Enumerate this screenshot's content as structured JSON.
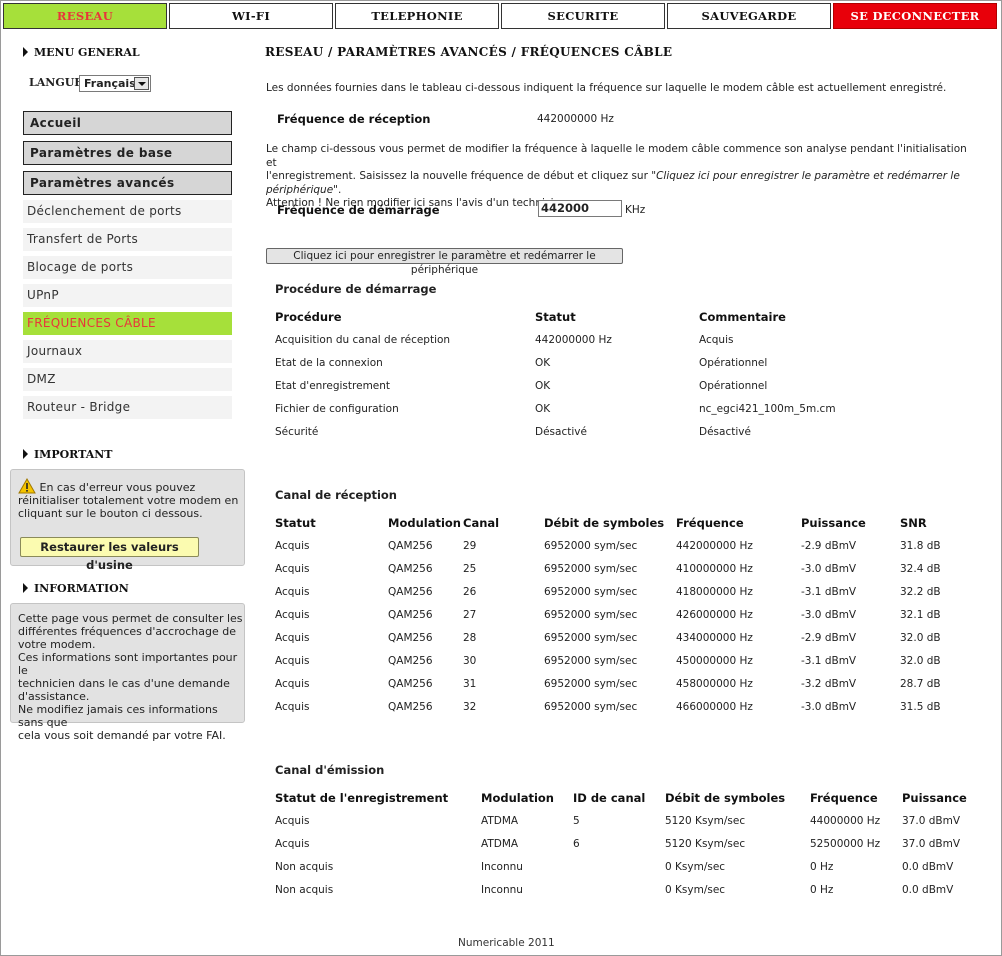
{
  "nav": {
    "tabs": [
      "RESEAU",
      "WI-FI",
      "TELEPHONIE",
      "SECURITE",
      "SAUVEGARDE"
    ],
    "logout": "SE DECONNECTER",
    "colors": {
      "active_bg": "#a6e03a",
      "active_text": "#e8353b",
      "logout_bg": "#e8000a"
    }
  },
  "sidebar": {
    "menu_general": "MENU GENERAL",
    "langue_label": "LANGUE",
    "langue_value": "Français",
    "main_items": [
      "Accueil",
      "Paramètres de base",
      "Paramètres avancés"
    ],
    "sub_items": [
      "Déclenchement de ports",
      "Transfert de Ports",
      "Blocage de ports",
      "UPnP",
      "FRÉQUENCES CÂBLE",
      "Journaux",
      "DMZ",
      "Routeur - Bridge"
    ],
    "important_title": "IMPORTANT",
    "important_text": "En cas d'erreur vous pouvez réinitialiser totalement votre modem en cliquant sur le bouton ci dessous.",
    "restore_label": "Restaurer les valeurs d'usine",
    "information_title": "INFORMATION",
    "info_lines": [
      "Cette page vous permet de consulter les",
      "différentes fréquences d'accrochage de",
      "votre modem.",
      "Ces informations sont importantes pour le",
      "technicien dans le cas d'une demande",
      "d'assistance.",
      "Ne modifiez jamais ces informations sans que",
      "cela vous soit demandé par votre FAI."
    ]
  },
  "main": {
    "title": "RESEAU / PARAMÈTRES AVANCÉS / FRÉQUENCES CÂBLE",
    "intro": "Les données fournies dans le tableau ci-dessous indiquent la fréquence sur laquelle le modem câble est actuellement enregistré.",
    "rx_freq_label": "Fréquence de réception",
    "rx_freq_value": "442000000 Hz",
    "desc_line1": "Le champ ci-dessous vous permet de modifier la fréquence à laquelle le modem câble commence son analyse pendant l'initialisation et",
    "desc_line2_a": "l'enregistrement. Saisissez la nouvelle fréquence de début et cliquez sur ",
    "desc_line2_b": "\"Cliquez ici pour enregistrer le paramètre et redémarrer le périphérique\"",
    "desc_line2_c": ".",
    "desc_line3": "Attention ! Ne rien modifier ici sans l'avis d'un technicien.",
    "start_freq_label": "Fréquence de démarrage",
    "start_freq_value": "442000",
    "start_freq_unit": "KHz",
    "save_button": "Cliquez ici pour enregistrer le paramètre et redémarrer le périphérique",
    "startup": {
      "title": "Procédure de démarrage",
      "headers": [
        "Procédure",
        "Statut",
        "Commentaire"
      ],
      "rows": [
        [
          "Acquisition du canal de réception",
          "442000000 Hz",
          "Acquis"
        ],
        [
          "Etat de la connexion",
          "OK",
          "Opérationnel"
        ],
        [
          "Etat d'enregistrement",
          "OK",
          "Opérationnel"
        ],
        [
          "Fichier de configuration",
          "OK",
          "nc_egci421_100m_5m.cm"
        ],
        [
          "Sécurité",
          "Désactivé",
          "Désactivé"
        ]
      ]
    },
    "downstream": {
      "title": "Canal de réception",
      "headers": [
        "Statut",
        "Modulation",
        "Canal",
        "Débit de symboles",
        "Fréquence",
        "Puissance",
        "SNR"
      ],
      "rows": [
        [
          "Acquis",
          "QAM256",
          "29",
          "6952000 sym/sec",
          "442000000 Hz",
          "-2.9 dBmV",
          "31.8 dB"
        ],
        [
          "Acquis",
          "QAM256",
          "25",
          "6952000 sym/sec",
          "410000000 Hz",
          "-3.0 dBmV",
          "32.4 dB"
        ],
        [
          "Acquis",
          "QAM256",
          "26",
          "6952000 sym/sec",
          "418000000 Hz",
          "-3.1 dBmV",
          "32.2 dB"
        ],
        [
          "Acquis",
          "QAM256",
          "27",
          "6952000 sym/sec",
          "426000000 Hz",
          "-3.0 dBmV",
          "32.1 dB"
        ],
        [
          "Acquis",
          "QAM256",
          "28",
          "6952000 sym/sec",
          "434000000 Hz",
          "-2.9 dBmV",
          "32.0 dB"
        ],
        [
          "Acquis",
          "QAM256",
          "30",
          "6952000 sym/sec",
          "450000000 Hz",
          "-3.1 dBmV",
          "32.0 dB"
        ],
        [
          "Acquis",
          "QAM256",
          "31",
          "6952000 sym/sec",
          "458000000 Hz",
          "-3.2 dBmV",
          "28.7 dB"
        ],
        [
          "Acquis",
          "QAM256",
          "32",
          "6952000 sym/sec",
          "466000000 Hz",
          "-3.0 dBmV",
          "31.5 dB"
        ]
      ]
    },
    "upstream": {
      "title": "Canal d'émission",
      "headers": [
        "Statut de l'enregistrement",
        "Modulation",
        "ID de canal",
        "Débit de symboles",
        "Fréquence",
        "Puissance"
      ],
      "rows": [
        [
          "Acquis",
          "ATDMA",
          "5",
          "5120 Ksym/sec",
          "44000000 Hz",
          "37.0 dBmV"
        ],
        [
          "Acquis",
          "ATDMA",
          "6",
          "5120 Ksym/sec",
          "52500000 Hz",
          "37.0 dBmV"
        ],
        [
          "Non acquis",
          "Inconnu",
          "",
          "0 Ksym/sec",
          "0 Hz",
          "0.0 dBmV"
        ],
        [
          "Non acquis",
          "Inconnu",
          "",
          "0 Ksym/sec",
          "0 Hz",
          "0.0 dBmV"
        ]
      ]
    }
  },
  "footer": "Numericable 2011"
}
